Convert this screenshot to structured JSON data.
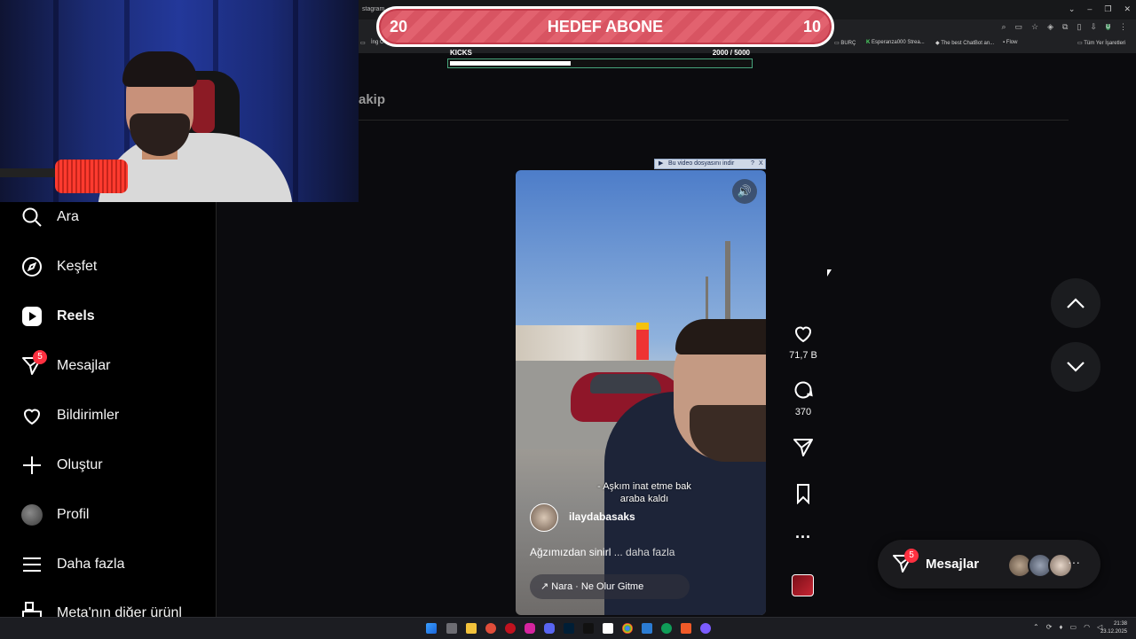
{
  "browser": {
    "tab_title": "stagram",
    "bookmarks": [
      "İng C",
      "BURÇ",
      "Esperanza000 Strea...",
      "The best ChatBot an...",
      "Flow",
      "Tüm Yer İşaretleri"
    ],
    "profile_initial": "U"
  },
  "overlay": {
    "goal_left": "20",
    "goal_title": "HEDEF ABONE",
    "goal_right": "10",
    "kicks_label": "KICKS",
    "kicks_count": "2000  / 5000",
    "kicks_progress": 0.4
  },
  "sidebar": {
    "items": [
      {
        "label": "Ara",
        "icon": "search-icon"
      },
      {
        "label": "Keşfet",
        "icon": "compass-icon"
      },
      {
        "label": "Reels",
        "icon": "reels-icon",
        "active": true
      },
      {
        "label": "Mesajlar",
        "icon": "messenger-icon",
        "badge": "5"
      },
      {
        "label": "Bildirimler",
        "icon": "heart-icon"
      },
      {
        "label": "Oluştur",
        "icon": "plus-icon"
      },
      {
        "label": "Profil",
        "icon": "profile-avatar"
      },
      {
        "label": "Daha fazla",
        "icon": "menu-icon"
      },
      {
        "label": "Meta'nın diğer ürünl",
        "icon": "meta-icon"
      }
    ]
  },
  "main": {
    "header_fragment": "akip",
    "download_bar": {
      "label": "Bu video dosyasını indir",
      "help": "?",
      "close": "X"
    }
  },
  "reel": {
    "caption_line1": "- Aşkım inat etme bak",
    "caption_line2": "araba kaldı",
    "author": "ilaydabasaks",
    "description": "Ağzımızdan sinirl",
    "more": "... daha fazla",
    "music": "↗ Nara · Ne Olur Gitme",
    "likes": "71,7 B",
    "comments": "370"
  },
  "messages_pill": {
    "label": "Mesajlar",
    "badge": "5",
    "more": "···"
  },
  "taskbar": {
    "time": "21:38",
    "date": "23.12.2025"
  },
  "colors": {
    "accent_red": "#ff3040",
    "goal_pink": "#e2626f",
    "bg": "#0a0a0c"
  }
}
